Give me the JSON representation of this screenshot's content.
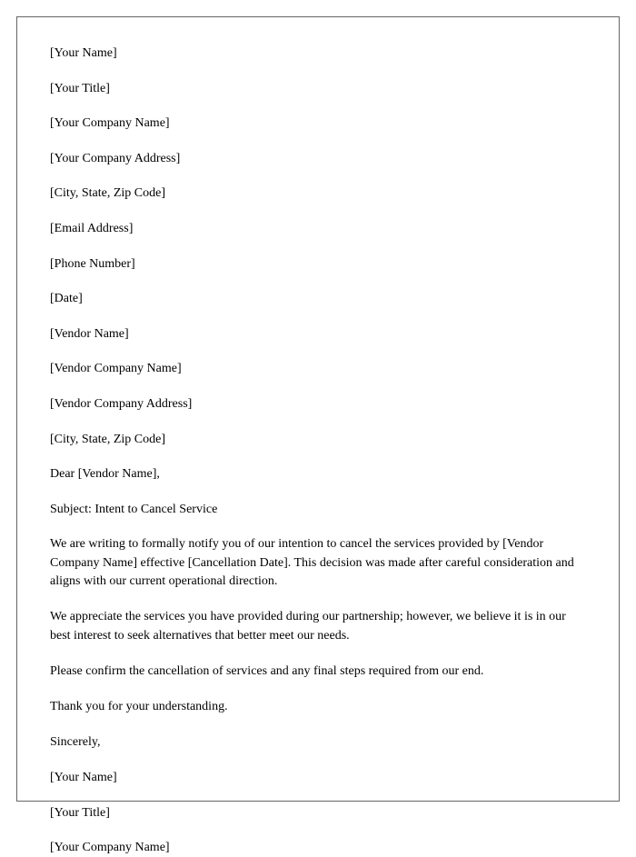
{
  "sender": {
    "name": "[Your Name]",
    "title": "[Your Title]",
    "company": "[Your Company Name]",
    "address": "[Your Company Address]",
    "cityStateZip": "[City, State, Zip Code]",
    "email": "[Email Address]",
    "phone": "[Phone Number]"
  },
  "date": "[Date]",
  "vendor": {
    "name": "[Vendor Name]",
    "company": "[Vendor Company Name]",
    "address": "[Vendor Company Address]",
    "cityStateZip": "[City, State, Zip Code]"
  },
  "greeting": "Dear [Vendor Name],",
  "subject": "Subject: Intent to Cancel Service",
  "body": {
    "p1": "We are writing to formally notify you of our intention to cancel the services provided by [Vendor Company Name] effective [Cancellation Date]. This decision was made after careful consideration and aligns with our current operational direction.",
    "p2": "We appreciate the services you have provided during our partnership; however, we believe it is in our best interest to seek alternatives that better meet our needs.",
    "p3": "Please confirm the cancellation of services and any final steps required from our end.",
    "p4": "Thank you for your understanding."
  },
  "closing": "Sincerely,",
  "signature": {
    "name": "[Your Name]",
    "title": "[Your Title]",
    "company": "[Your Company Name]"
  }
}
